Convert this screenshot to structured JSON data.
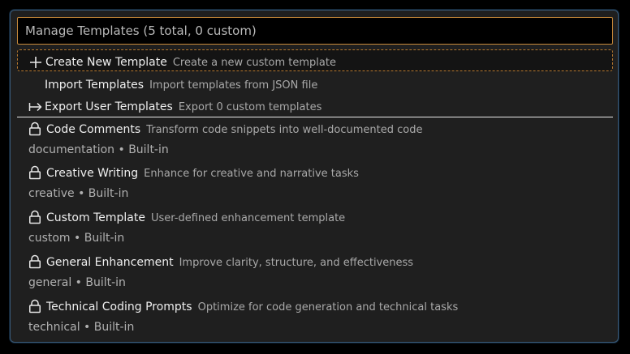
{
  "search": {
    "value": "Manage Templates (5 total, 0 custom)"
  },
  "actions": [
    {
      "icon": "plus-icon",
      "label": "Create New Template",
      "description": "Create a new custom template"
    },
    {
      "icon": "",
      "label": "Import Templates",
      "description": "Import templates from JSON file"
    },
    {
      "icon": "arrow-right-bar-icon",
      "label": "Export User Templates",
      "description": "Export 0 custom templates"
    }
  ],
  "templates": [
    {
      "icon": "lock-icon",
      "label": "Code Comments",
      "description": "Transform code snippets into well-documented code",
      "detail": "documentation • Built-in"
    },
    {
      "icon": "lock-icon",
      "label": "Creative Writing",
      "description": "Enhance for creative and narrative tasks",
      "detail": "creative • Built-in"
    },
    {
      "icon": "lock-icon",
      "label": "Custom Template",
      "description": "User-defined enhancement template",
      "detail": "custom • Built-in"
    },
    {
      "icon": "lock-icon",
      "label": "General Enhancement",
      "description": "Improve clarity, structure, and effectiveness",
      "detail": "general • Built-in"
    },
    {
      "icon": "lock-icon",
      "label": "Technical Coding Prompts",
      "description": "Optimize for code generation and technical tasks",
      "detail": "technical • Built-in"
    }
  ],
  "colors": {
    "focus_border": "#c98a3a",
    "panel_border": "#3a5a78",
    "panel_bg": "#1f1f1f"
  }
}
